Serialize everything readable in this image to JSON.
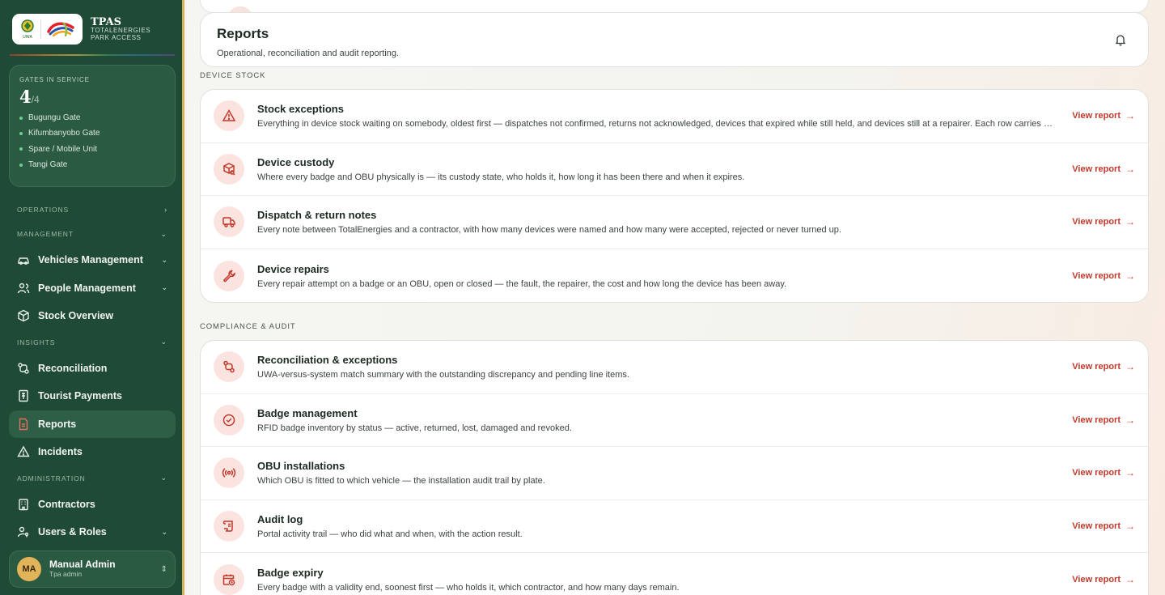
{
  "brand": {
    "logo_text": "UWA",
    "title": "TPAS",
    "subtitle_line1": "TOTALENERGIES",
    "subtitle_line2": "PARK ACCESS"
  },
  "gates": {
    "label": "GATES IN SERVICE",
    "active": "4",
    "total": "/4",
    "list": [
      "Bugungu Gate",
      "Kifumbanyobo Gate",
      "Spare / Mobile Unit",
      "Tangi Gate"
    ]
  },
  "nav": {
    "operations": "OPERATIONS",
    "management": "MANAGEMENT",
    "vehicles": "Vehicles Management",
    "people": "People Management",
    "stock": "Stock Overview",
    "insights": "INSIGHTS",
    "reconciliation": "Reconciliation",
    "tourist_payments": "Tourist Payments",
    "reports": "Reports",
    "incidents": "Incidents",
    "administration": "ADMINISTRATION",
    "contractors": "Contractors",
    "users_roles": "Users & Roles"
  },
  "user": {
    "initials": "MA",
    "name": "Manual Admin",
    "role": "Tpa admin"
  },
  "header": {
    "title": "Reports",
    "subtitle": "Operational, reconciliation and audit reporting."
  },
  "sections": {
    "device_stock": "DEVICE STOCK",
    "compliance": "COMPLIANCE & AUDIT"
  },
  "view_report_label": "View report",
  "device_stock_reports": [
    {
      "title": "Stock exceptions",
      "desc": "Everything in device stock waiting on somebody, oldest first — dispatches not confirmed, returns not acknowledged, devices that expired while still held, and devices still at a repairer. Each row carries who is holding it up."
    },
    {
      "title": "Device custody",
      "desc": "Where every badge and OBU physically is — its custody state, who holds it, how long it has been there and when it expires."
    },
    {
      "title": "Dispatch & return notes",
      "desc": "Every note between TotalEnergies and a contractor, with how many devices were named and how many were accepted, rejected or never turned up."
    },
    {
      "title": "Device repairs",
      "desc": "Every repair attempt on a badge or an OBU, open or closed — the fault, the repairer, the cost and how long the device has been away."
    }
  ],
  "compliance_reports": [
    {
      "title": "Reconciliation & exceptions",
      "desc": "UWA-versus-system match summary with the outstanding discrepancy and pending line items."
    },
    {
      "title": "Badge management",
      "desc": "RFID badge inventory by status — active, returned, lost, damaged and revoked."
    },
    {
      "title": "OBU installations",
      "desc": "Which OBU is fitted to which vehicle — the installation audit trail by plate."
    },
    {
      "title": "Audit log",
      "desc": "Portal activity trail — who did what and when, with the action result."
    },
    {
      "title": "Badge expiry",
      "desc": "Every badge with a validity end, soonest first — who holds it, which contractor, and how many days remain."
    }
  ],
  "colors": {
    "sidebar": "#1f4a35",
    "accent": "#c0392b",
    "icon_bg": "#fbe4e0",
    "gate_dot": "#6fcf8a"
  }
}
